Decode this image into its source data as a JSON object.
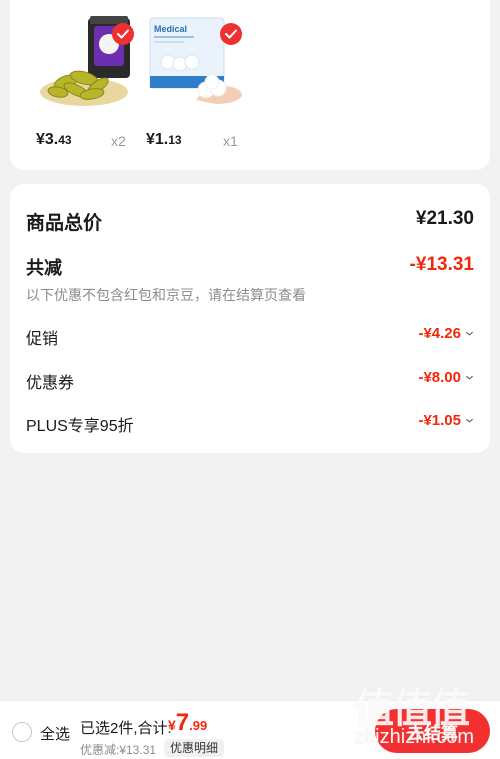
{
  "products": [
    {
      "image": "pickled-vegetable-jar-icon",
      "price_main": "¥3.",
      "price_cents": "43",
      "qty": "x2",
      "selected": true
    },
    {
      "image": "medical-cotton-balls-icon",
      "price_main": "¥1.",
      "price_cents": "13",
      "qty": "x1",
      "selected": true,
      "package_text": "Medical"
    }
  ],
  "summary": {
    "total_label": "商品总价",
    "total_value": "¥21.30",
    "reduce_label": "共减",
    "reduce_value": "-¥13.31",
    "note": "以下优惠不包含红包和京豆，请在结算页查看",
    "items": [
      {
        "label": "促销",
        "value": "-¥4.26"
      },
      {
        "label": "优惠券",
        "value": "-¥8.00"
      },
      {
        "label": "PLUS专享95折",
        "value": "-¥1.05"
      }
    ]
  },
  "bottom_bar": {
    "select_all": "全选",
    "selected_text": "已选2件,合计:",
    "total_yen": "¥",
    "total_big": "7",
    "total_small": ".99",
    "discount_text": "优惠减:¥13.31",
    "detail_button": "优惠明细",
    "checkout_button": "去结算"
  },
  "watermark": {
    "logo": "值值值",
    "url": "zhizhizhi.com"
  },
  "colors": {
    "accent": "#f2270c",
    "checkout": "#f23030"
  }
}
